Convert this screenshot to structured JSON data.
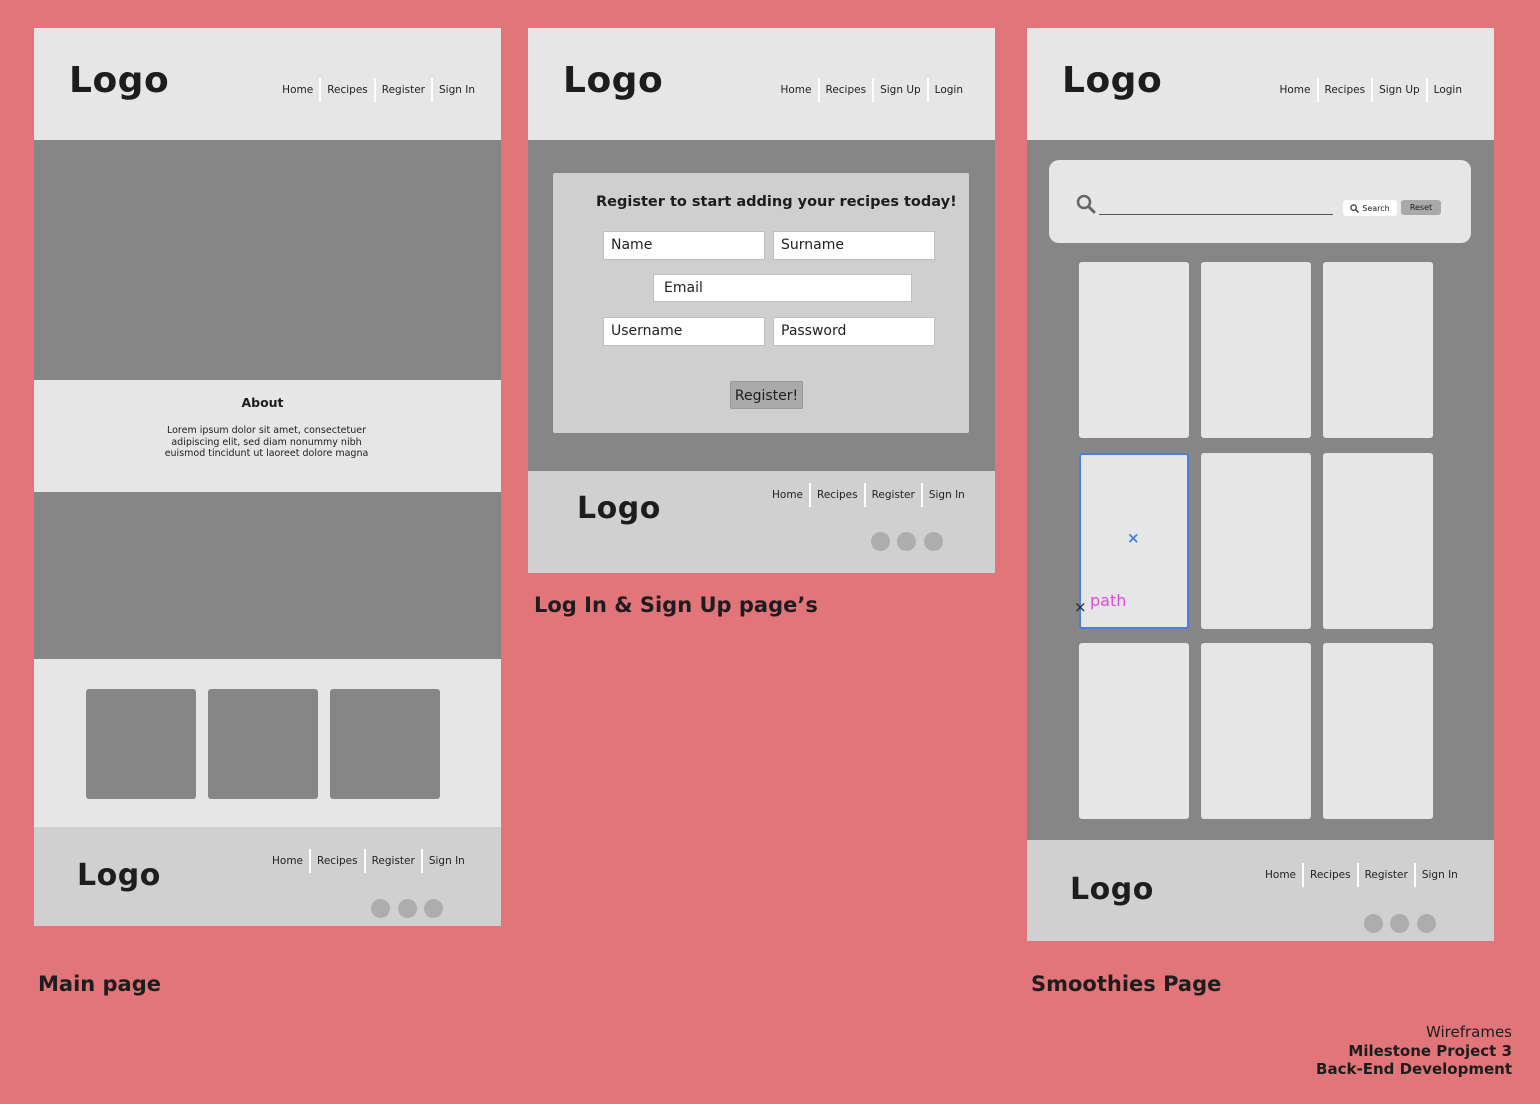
{
  "main_page": {
    "logo": "Logo",
    "nav": [
      "Home",
      "Recipes",
      "Register",
      "Sign In"
    ],
    "about_title": "About",
    "about_text_lines": [
      "Lorem ipsum dolor sit amet, consectetuer",
      "adipiscing elit, sed diam nonummy nibh",
      "euismod tincidunt ut laoreet dolore magna"
    ],
    "footer_logo": "Logo",
    "footer_nav": [
      "Home",
      "Recipes",
      "Register",
      "Sign In"
    ],
    "caption": "Main page"
  },
  "login_page": {
    "logo": "Logo",
    "nav": [
      "Home",
      "Recipes",
      "Sign Up",
      "Login"
    ],
    "form_title": "Register to start adding your recipes today!",
    "fields": {
      "name": "Name",
      "surname": "Surname",
      "email": "Email",
      "username": "Username",
      "password": "Password"
    },
    "register_button": "Register!",
    "footer_logo": "Logo",
    "footer_nav": [
      "Home",
      "Recipes",
      "Register",
      "Sign In"
    ],
    "caption": "Log In & Sign Up page’s"
  },
  "smoothies_page": {
    "logo": "Logo",
    "nav": [
      "Home",
      "Recipes",
      "Sign Up",
      "Login"
    ],
    "search_button": "Search",
    "reset_button": "Reset",
    "selection_label": "path",
    "footer_logo": "Logo",
    "footer_nav": [
      "Home",
      "Recipes",
      "Register",
      "Sign In"
    ],
    "caption": "Smoothies Page"
  },
  "credits": {
    "line1": "Wireframes",
    "line2": "Milestone Project 3",
    "line3": "Back-End Development"
  },
  "icons": {
    "search": "search-icon",
    "social": "social-circle-icon",
    "selection_center": "cross-icon"
  },
  "colors": {
    "background": "#e2757a",
    "header": "#e6e6e6",
    "content_gray": "#858685",
    "footer": "#d0d0d0",
    "selection": "#4a7fd8",
    "path_label": "#e04be0"
  }
}
